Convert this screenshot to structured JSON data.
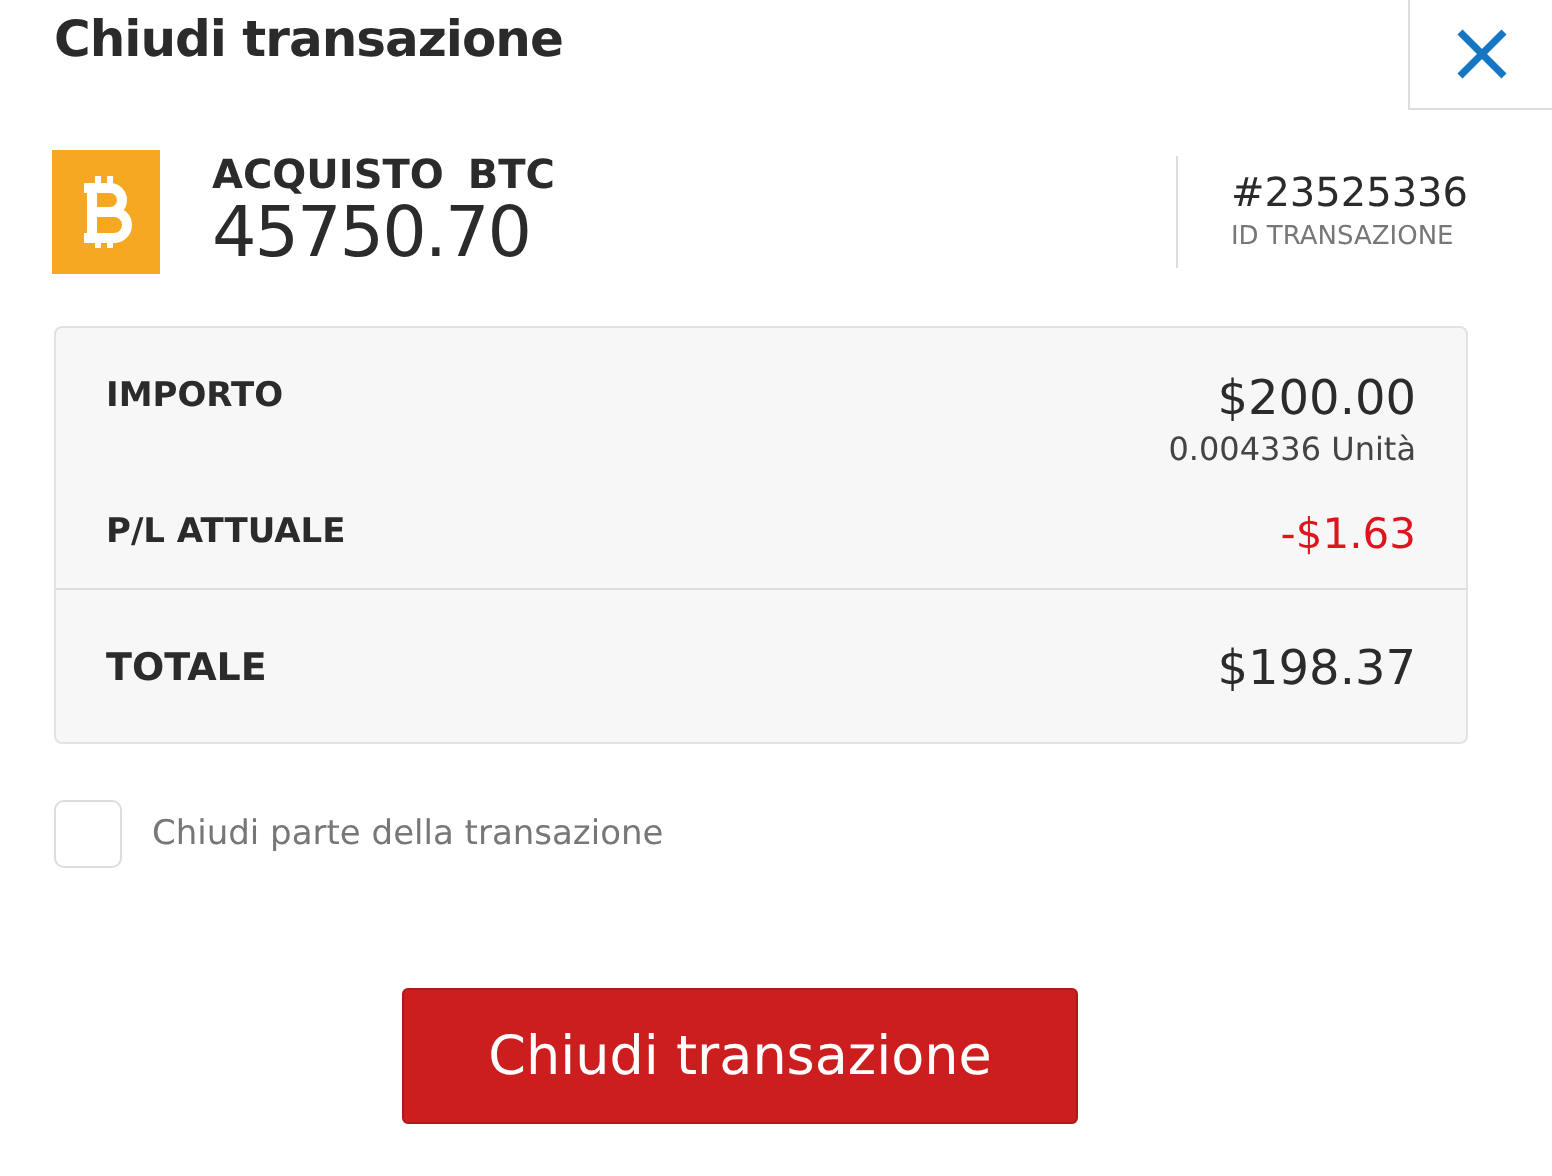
{
  "dialog": {
    "title": "Chiudi transazione"
  },
  "trade": {
    "side": "ACQUISTO",
    "symbol": "BTC",
    "rate": "45750.70",
    "id": "#23525336",
    "id_label": "ID TRANSAZIONE"
  },
  "summary": {
    "rows": [
      {
        "label": "IMPORTO",
        "value": "$200.00",
        "sub": "0.004336 Unità",
        "negative": false
      },
      {
        "label": "P/L ATTUALE",
        "value": "-$1.63",
        "negative": true
      }
    ],
    "total": {
      "label": "TOTALE",
      "value": "$198.37"
    }
  },
  "partial": {
    "label": "Chiudi parte della transazione",
    "checked": false
  },
  "button": {
    "label": "Chiudi transazione"
  }
}
